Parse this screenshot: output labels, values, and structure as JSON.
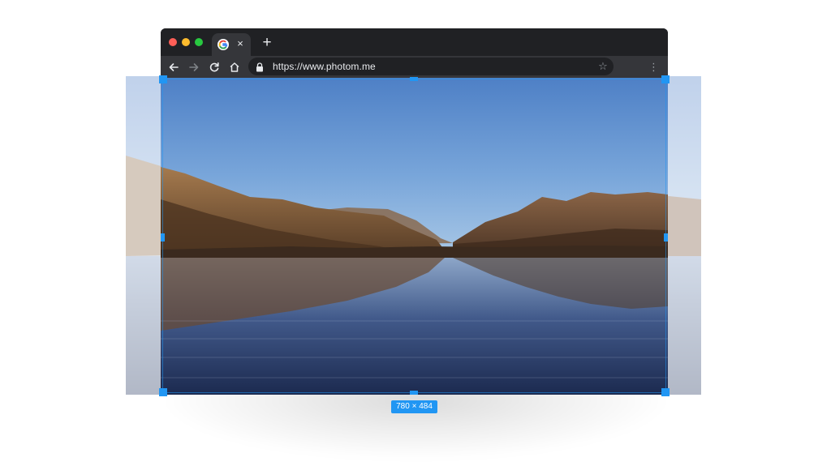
{
  "browser": {
    "tab": {
      "favicon": "google-g-icon",
      "close_label": "×"
    },
    "new_tab_label": "+",
    "toolbar": {
      "back": "arrow-left-icon",
      "forward": "arrow-right-icon",
      "reload": "reload-icon",
      "home": "home-icon"
    },
    "address_bar": {
      "url": "https://www.photom.me",
      "lock": "lock-icon",
      "bookmark_label": "☆"
    },
    "menu_label": "⋮"
  },
  "crop": {
    "size_label": "780 × 484"
  },
  "colors": {
    "accent": "#2196f3",
    "chrome_dark": "#202124",
    "chrome_toolbar": "#35363a"
  }
}
